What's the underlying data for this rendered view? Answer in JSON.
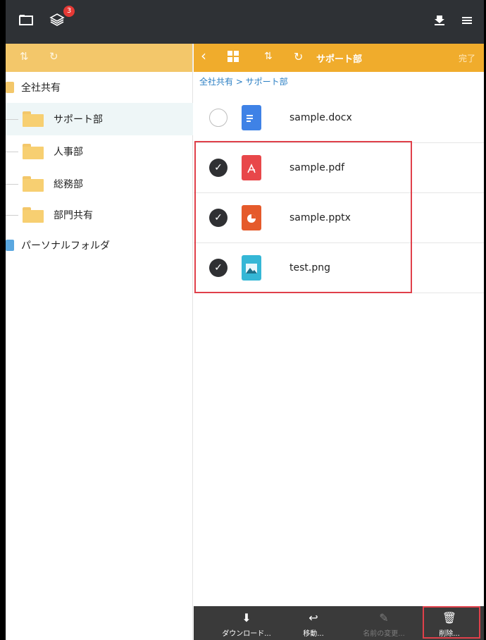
{
  "topbar": {
    "folder_icon": "folder-icon",
    "layers_icon": "layers-icon",
    "badge_count": "3",
    "download_icon": "download-icon",
    "menu_icon": "menu-icon"
  },
  "left": {
    "toolbar": {
      "sort_icon": "sort-icon",
      "refresh_icon": "refresh-icon"
    },
    "root_shared": "全社共有",
    "items": [
      {
        "label": "サポート部",
        "selected": true
      },
      {
        "label": "人事部"
      },
      {
        "label": "総務部"
      },
      {
        "label": "部門共有"
      }
    ],
    "root_personal": "パーソナルフォルダ"
  },
  "right": {
    "toolbar": {
      "back_icon": "back-chevron-icon",
      "grid_icon": "grid-view-icon",
      "sort_icon": "sort-icon",
      "refresh_icon": "refresh-icon",
      "title": "サポート部",
      "done": "完了"
    },
    "breadcrumb": "全社共有 > サポート部",
    "files": [
      {
        "name": "sample.docx",
        "checked": false,
        "icon": "docx-file-icon",
        "color": "#3f82e6"
      },
      {
        "name": "sample.pdf",
        "checked": true,
        "icon": "pdf-file-icon",
        "color": "#e8474a"
      },
      {
        "name": "sample.pptx",
        "checked": true,
        "icon": "pptx-file-icon",
        "color": "#e55a2b"
      },
      {
        "name": "test.png",
        "checked": true,
        "icon": "image-file-icon",
        "color": "#35b7d6"
      }
    ]
  },
  "bottombar": {
    "download": "ダウンロード...",
    "move": "移動...",
    "rename": "名前の変更...",
    "delete": "削除..."
  },
  "colors": {
    "topbar": "#2e3135",
    "left_toolbar": "#f3c76a",
    "right_toolbar": "#f0ac2c",
    "highlight_border": "#e0404a",
    "breadcrumb": "#2b7fc4"
  }
}
